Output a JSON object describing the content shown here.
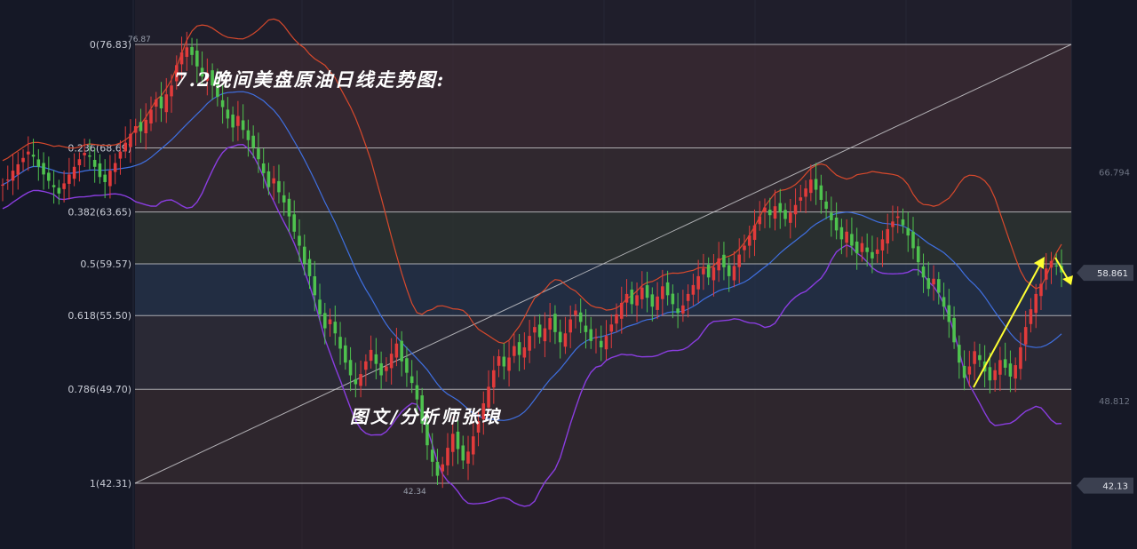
{
  "chart_data": {
    "type": "candlestick",
    "title": "7.2晚间美盘原油日线走势图:",
    "watermark": "图文/分析师张琅",
    "fib_levels": [
      {
        "label": "0(76.83)",
        "ratio": 0,
        "price": 76.83
      },
      {
        "label": "0.236(68.69)",
        "ratio": 0.236,
        "price": 68.69
      },
      {
        "label": "0.382(63.65)",
        "ratio": 0.382,
        "price": 63.65
      },
      {
        "label": "0.5(59.57)",
        "ratio": 0.5,
        "price": 59.57
      },
      {
        "label": "0.618(55.50)",
        "ratio": 0.618,
        "price": 55.5
      },
      {
        "label": "0.786(49.70)",
        "ratio": 0.786,
        "price": 49.7
      },
      {
        "label": "1(42.31)",
        "ratio": 1,
        "price": 42.31
      }
    ],
    "annotations": {
      "high_label": "76.87",
      "low_label": "42.34"
    },
    "price_axis": [
      {
        "label": "66.794",
        "price": 66.794,
        "tag": false
      },
      {
        "label": "58.861",
        "price": 58.861,
        "tag": true
      },
      {
        "label": "48.812",
        "price": 48.812,
        "tag": false
      },
      {
        "label": "42.13",
        "price": 42.13,
        "tag": true
      }
    ],
    "ylim": [
      38.3,
      78.5
    ],
    "close_series": [
      65.8,
      66.2,
      66.9,
      67.4,
      67.9,
      68.4,
      68.0,
      67.2,
      66.6,
      66.1,
      65.6,
      65.1,
      65.9,
      66.6,
      67.2,
      67.8,
      68.3,
      68.0,
      67.2,
      66.4,
      66.0,
      66.9,
      67.5,
      68.4,
      69.1,
      69.8,
      70.4,
      70.0,
      70.9,
      71.7,
      72.5,
      71.8,
      72.9,
      73.6,
      75.2,
      76.2,
      76.6,
      76.0,
      75.1,
      74.3,
      74.6,
      73.6,
      72.7,
      71.9,
      71.0,
      70.3,
      71.2,
      70.1,
      69.3,
      68.7,
      67.8,
      66.7,
      65.6,
      66.3,
      65.2,
      64.4,
      63.3,
      62.1,
      61.0,
      59.6,
      58.6,
      57.1,
      55.6,
      54.5,
      55.2,
      54.1,
      52.9,
      51.8,
      50.8,
      50.1,
      50.9,
      51.9,
      52.8,
      51.7,
      50.8,
      51.5,
      52.5,
      53.3,
      51.9,
      51.0,
      50.2,
      48.9,
      47.0,
      45.3,
      44.0,
      42.9,
      43.8,
      45.1,
      46.2,
      45.0,
      44.1,
      44.8,
      46.0,
      47.2,
      48.6,
      49.9,
      51.2,
      52.3,
      51.5,
      52.2,
      53.1,
      52.4,
      53.0,
      53.9,
      54.6,
      53.8,
      54.5,
      55.3,
      54.2,
      53.4,
      54.1,
      55.2,
      55.9,
      55.0,
      54.2,
      53.5,
      53.8,
      53.0,
      53.9,
      54.8,
      55.6,
      56.5,
      57.2,
      56.4,
      57.1,
      57.7,
      56.9,
      56.2,
      57.0,
      57.8,
      57.1,
      56.4,
      55.7,
      56.3,
      57.2,
      57.9,
      58.6,
      59.2,
      58.5,
      59.3,
      60.0,
      59.3,
      58.6,
      59.4,
      60.3,
      61.0,
      61.8,
      62.6,
      63.3,
      64.0,
      63.4,
      64.1,
      63.6,
      63.1,
      63.6,
      64.2,
      64.8,
      65.5,
      66.2,
      65.4,
      64.6,
      63.9,
      63.0,
      62.2,
      61.5,
      62.1,
      61.0,
      60.4,
      61.2,
      60.5,
      60.0,
      60.7,
      61.5,
      62.3,
      62.9,
      63.3,
      62.6,
      61.8,
      60.8,
      59.7,
      58.5,
      57.6,
      58.4,
      57.3,
      56.2,
      55.0,
      53.4,
      51.8,
      50.6,
      51.5,
      52.7,
      52.0,
      51.1,
      50.4,
      51.2,
      52.0,
      51.4,
      50.7,
      51.6,
      53.0,
      54.6,
      56.0,
      57.2,
      58.0,
      59.2,
      59.8,
      59.4,
      58.9
    ]
  }
}
